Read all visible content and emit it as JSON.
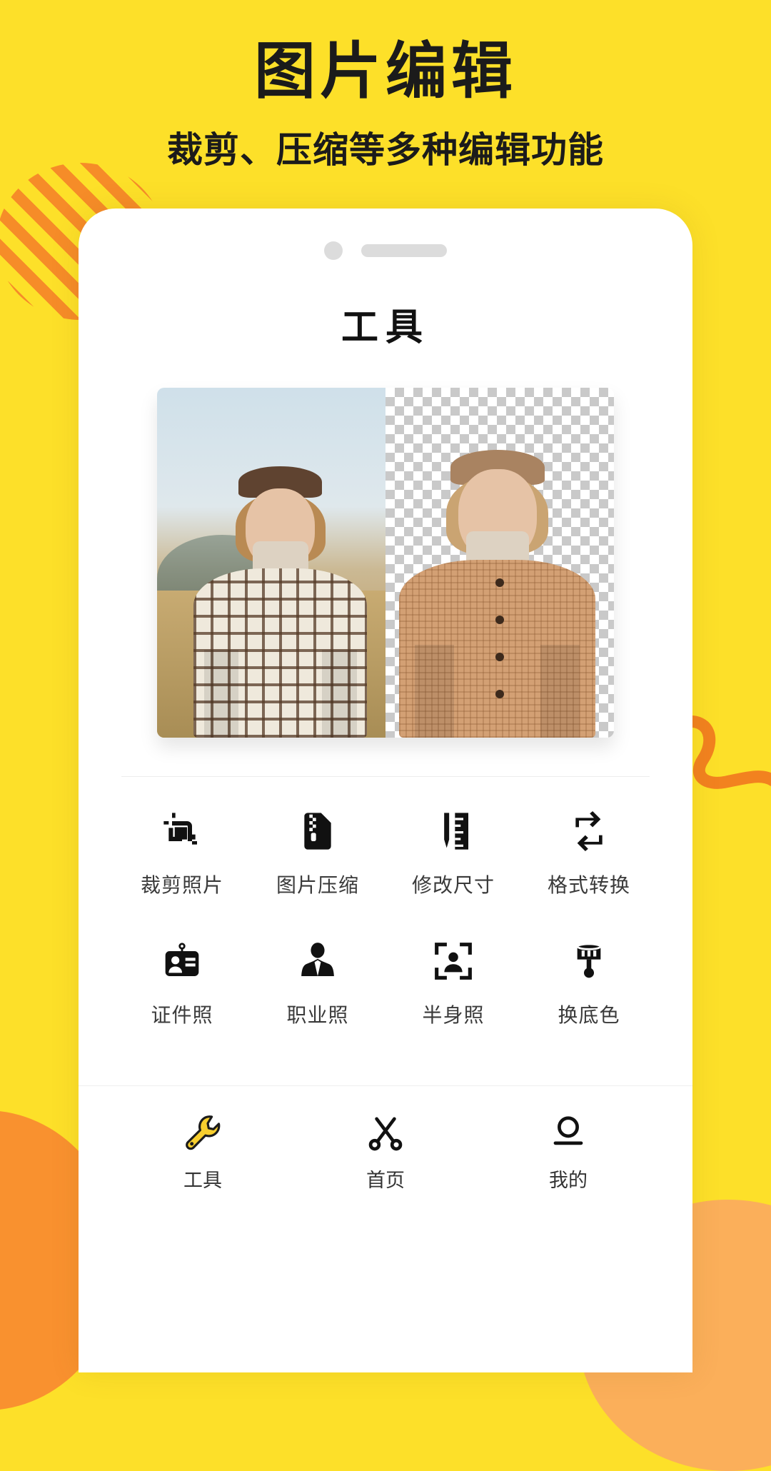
{
  "banner": {
    "title": "图片编辑",
    "subtitle": "裁剪、压缩等多种编辑功能"
  },
  "colors": {
    "background": "#FDE029",
    "accent_orange": "#F68C28",
    "accent_orange_light": "#FBAF5A",
    "nav_active": "#F7CE2E",
    "text_dark": "#1b1b1b"
  },
  "phone": {
    "status_bar": {
      "camera_icon": "camera-dot-icon",
      "speaker_icon": "speaker-bar-icon"
    },
    "page_title": "工具",
    "preview": {
      "left_panel_name": "original-photo",
      "right_panel_name": "cutout-transparent-photo",
      "checkerboard": "transparency-checkerboard"
    },
    "tools": [
      {
        "label": "裁剪照片",
        "icon": "crop-icon"
      },
      {
        "label": "图片压缩",
        "icon": "compress-file-icon"
      },
      {
        "label": "修改尺寸",
        "icon": "ruler-resize-icon"
      },
      {
        "label": "格式转换",
        "icon": "convert-loop-icon"
      },
      {
        "label": "证件照",
        "icon": "id-card-icon"
      },
      {
        "label": "职业照",
        "icon": "person-suit-icon"
      },
      {
        "label": "半身照",
        "icon": "person-scan-frame-icon"
      },
      {
        "label": "换底色",
        "icon": "paint-brush-icon"
      }
    ],
    "nav": [
      {
        "label": "工具",
        "icon": "wrench-icon",
        "active": true
      },
      {
        "label": "首页",
        "icon": "scissors-icon",
        "active": false
      },
      {
        "label": "我的",
        "icon": "person-outline-icon",
        "active": false
      }
    ]
  }
}
